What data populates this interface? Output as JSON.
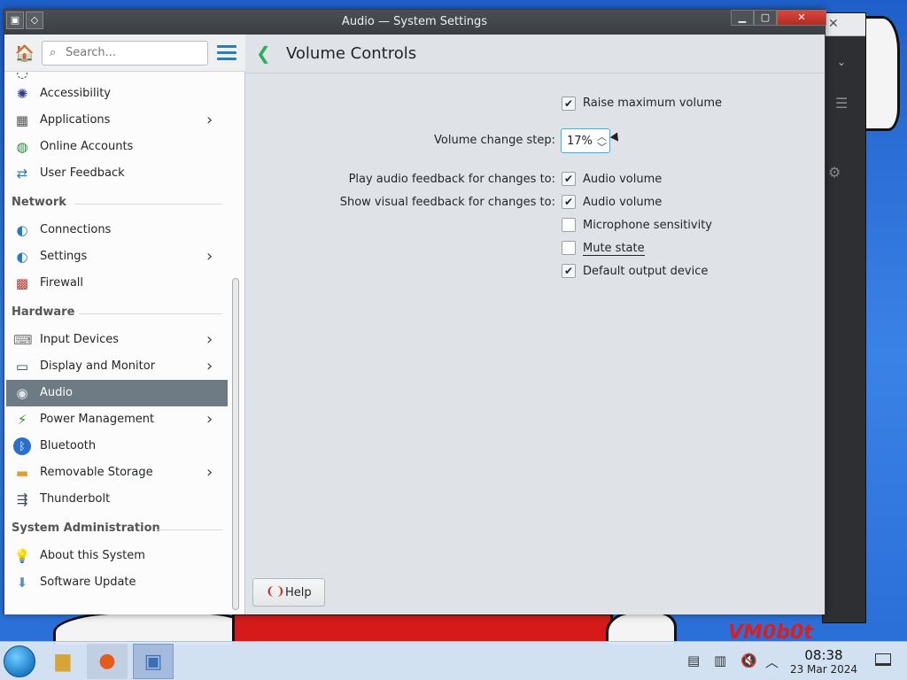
{
  "window": {
    "title": "Audio — System Settings"
  },
  "sidebar": {
    "search_placeholder": "Search...",
    "items_top": [
      {
        "label": "Accessibility",
        "icon": "accessibility-icon",
        "has_children": false
      },
      {
        "label": "Applications",
        "icon": "applications-icon",
        "has_children": true
      },
      {
        "label": "Online Accounts",
        "icon": "online-accounts-icon",
        "has_children": false
      },
      {
        "label": "User Feedback",
        "icon": "user-feedback-icon",
        "has_children": false
      }
    ],
    "sections": {
      "network": "Network",
      "hardware": "Hardware",
      "sysadmin": "System Administration"
    },
    "network_items": [
      {
        "label": "Connections",
        "has_children": false
      },
      {
        "label": "Settings",
        "has_children": true
      },
      {
        "label": "Firewall",
        "has_children": false
      }
    ],
    "hardware_items": [
      {
        "label": "Input Devices",
        "has_children": true
      },
      {
        "label": "Display and Monitor",
        "has_children": true
      },
      {
        "label": "Audio",
        "has_children": false,
        "active": true
      },
      {
        "label": "Power Management",
        "has_children": true
      },
      {
        "label": "Bluetooth",
        "has_children": false
      },
      {
        "label": "Removable Storage",
        "has_children": true
      },
      {
        "label": "Thunderbolt",
        "has_children": false
      }
    ],
    "sysadmin_items": [
      {
        "label": "About this System",
        "has_children": false
      },
      {
        "label": "Software Update",
        "has_children": false
      }
    ]
  },
  "content": {
    "title": "Volume Controls",
    "raise_max_volume": {
      "label": "Raise maximum volume",
      "checked": true
    },
    "volume_step": {
      "label": "Volume change step:",
      "value": "17%"
    },
    "play_feedback": {
      "label": "Play audio feedback for changes to:",
      "option": "Audio volume",
      "checked": true
    },
    "visual_feedback": {
      "label": "Show visual feedback for changes to:",
      "options": [
        {
          "label": "Audio volume",
          "checked": true
        },
        {
          "label": "Microphone sensitivity",
          "checked": false
        },
        {
          "label": "Mute state",
          "checked": false
        },
        {
          "label": "Default output device",
          "checked": true
        }
      ]
    },
    "help_label": "Help"
  },
  "taskbar": {
    "time": "08:38",
    "date": "23 Mar 2024"
  },
  "desktop": {
    "watermark": "VM0b0t"
  },
  "colors": {
    "accent": "#3daee9",
    "active_item": "#6e7b84",
    "back_arrow": "#27ae60"
  }
}
